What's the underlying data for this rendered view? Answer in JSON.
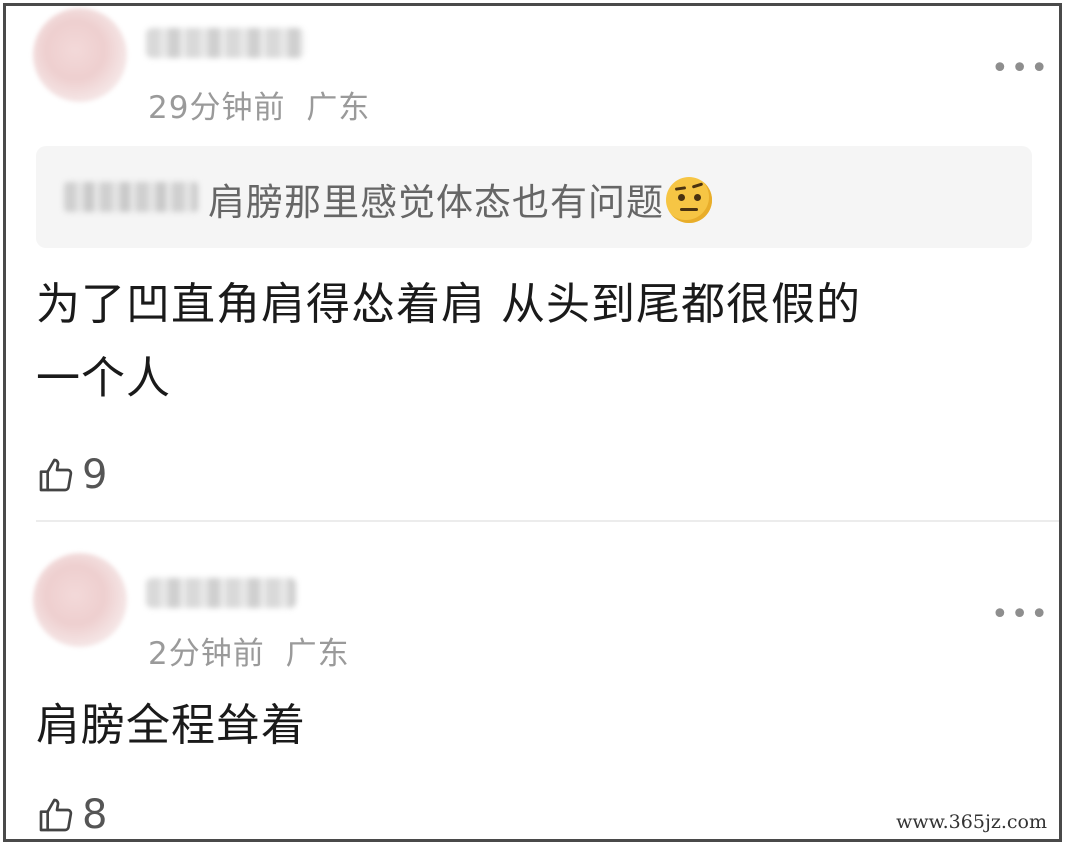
{
  "comments": [
    {
      "time": "29分钟前",
      "location": "广东",
      "quote_text": "肩膀那里感觉体态也有问题",
      "quote_emoji": "raised-eyebrow-emoji",
      "body_line1": "为了凹直角肩得怂着肩 从头到尾都很假的",
      "body_line2": "一个人",
      "likes": "9"
    },
    {
      "time": "2分钟前",
      "location": "广东",
      "body": "肩膀全程耸着",
      "likes": "8"
    }
  ],
  "more_label": "•••",
  "watermark": "www.365jz.com",
  "icons": {
    "like": "thumbs-up-icon",
    "more": "more-options-icon",
    "avatar": "avatar"
  }
}
